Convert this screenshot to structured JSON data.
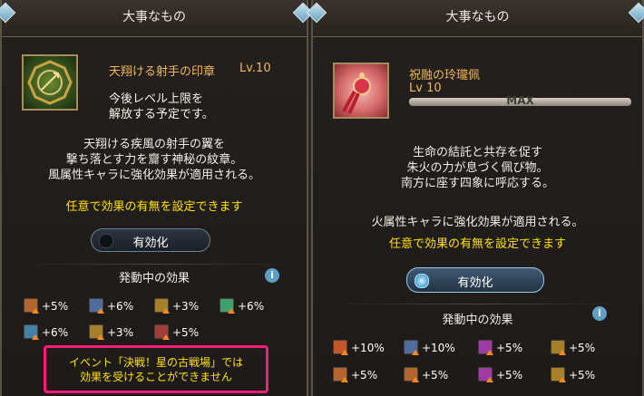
{
  "left_panel": {
    "header": "大事なもの",
    "item_name": "天翔ける射手の印章",
    "level": "Lv.10",
    "note": [
      "今後レベル上限を",
      "解放する予定です。"
    ],
    "description": [
      "天翔ける疾風の射手の翼を",
      "撃ち落とす力を齎す神秘の紋章。",
      "風属性キャラに強化効果が適用される。"
    ],
    "toggle_hint": "任意で効果の有無を設定できます",
    "toggle_label": "有効化",
    "effects_title": "発動中の効果",
    "info": "i",
    "effects": [
      {
        "value": "+5%",
        "icon": "attack-up-icon",
        "color": "#b2652f"
      },
      {
        "value": "+6%",
        "icon": "defense-up-icon",
        "color": "#4f6c9f"
      },
      {
        "value": "+3%",
        "icon": "double-attack-icon",
        "color": "#a67f2b"
      },
      {
        "value": "+6%",
        "icon": "heal-up-icon",
        "color": "#3f9f6d"
      },
      {
        "value": "+6%",
        "icon": "cure-icon",
        "color": "#447fa5"
      },
      {
        "value": "+3%",
        "icon": "triple-attack-icon",
        "color": "#a67f2b"
      },
      {
        "value": "+5%",
        "icon": "skill-up-icon",
        "color": "#9f3d3d"
      }
    ],
    "notice": [
      "イベント「決戦！星の古戦場」では",
      "効果を受けることができません"
    ],
    "colors": {
      "highlight": "#ff1b7a",
      "name": "#f1b85b",
      "hint": "#ffe200"
    }
  },
  "right_panel": {
    "header": "大事なもの",
    "item_name": "祝融の玲瓏佩",
    "level": "Lv 10",
    "max": "MAX",
    "description": [
      "生命の結託と共存を促す",
      "朱火の力が息づく佩び物。",
      "南方に座す四象に呼応する。"
    ],
    "element_line": "火属性キャラに強化効果が適用される。",
    "toggle_hint": "任意で効果の有無を設定できます",
    "toggle_label": "有効化",
    "effects_title": "発動中の効果",
    "info": "i",
    "effects": [
      {
        "value": "+10%",
        "icon": "hp-up-icon",
        "color": "#c2552a"
      },
      {
        "value": "+10%",
        "icon": "defense-up-icon",
        "color": "#4f6c9f"
      },
      {
        "value": "+5%",
        "icon": "crit-icon",
        "color": "#9d3ca5"
      },
      {
        "value": "+5%",
        "icon": "double-attack-icon",
        "color": "#a67f2b"
      },
      {
        "value": "+5%",
        "icon": "attack-up-icon",
        "color": "#b2652f"
      },
      {
        "value": "+5%",
        "icon": "skill-up-icon",
        "color": "#b2652f"
      },
      {
        "value": "+5%",
        "icon": "crit-icon",
        "color": "#9d3ca5"
      },
      {
        "value": "+5%",
        "icon": "triple-attack-icon",
        "color": "#a67f2b"
      }
    ]
  }
}
